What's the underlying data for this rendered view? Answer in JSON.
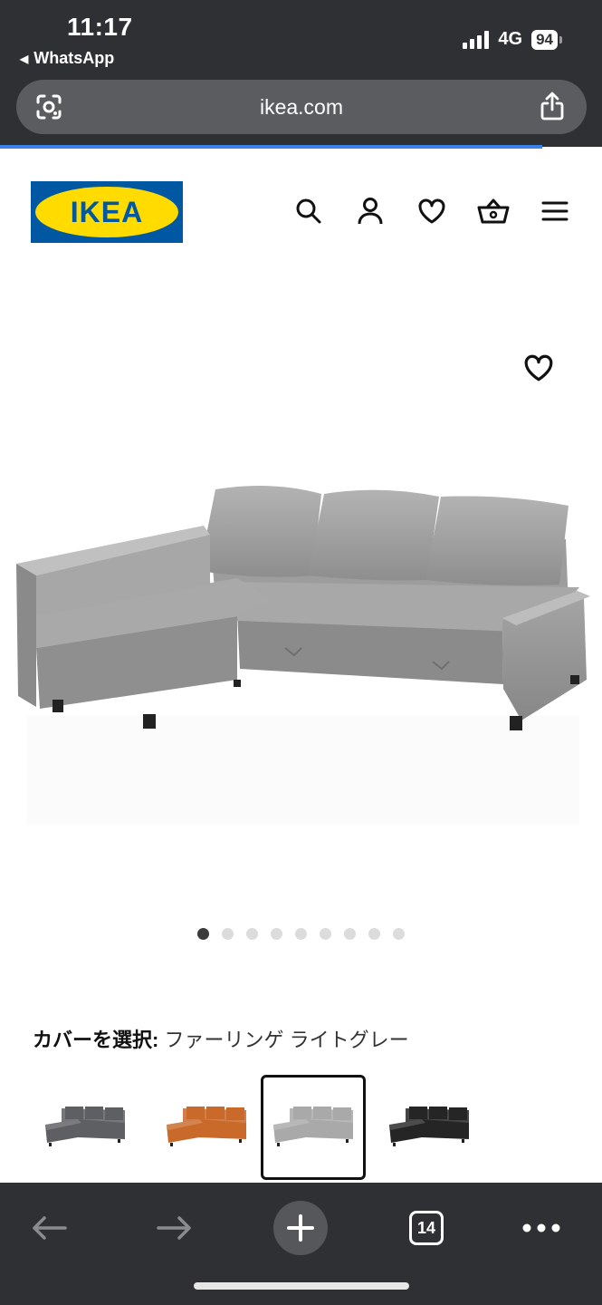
{
  "status_bar": {
    "time": "11:17",
    "back_app": "WhatsApp",
    "network": "4G",
    "battery": "94"
  },
  "browser": {
    "url": "ikea.com",
    "load_progress_percent": 90,
    "tab_count": "14"
  },
  "header": {
    "logo_text": "IKEA",
    "icons": [
      "search-icon",
      "account-icon",
      "heart-icon",
      "basket-icon",
      "menu-icon"
    ]
  },
  "gallery": {
    "image_count": 9,
    "active_index": 0
  },
  "cover": {
    "label": "カバーを選択:",
    "selected_value": "ファーリンゲ ライトグレー",
    "swatches": [
      {
        "name": "dark-grey",
        "color": "#5e5f63",
        "selected": false
      },
      {
        "name": "orange-leather",
        "color": "#c9692a",
        "selected": false
      },
      {
        "name": "light-grey",
        "color": "#a9a9a9",
        "selected": true
      },
      {
        "name": "black-leather",
        "color": "#252525",
        "selected": false
      }
    ]
  },
  "colors": {
    "ikea_blue": "#0058a3",
    "ikea_yellow": "#ffdb00",
    "chrome": "#2f3033",
    "progress": "#3b82e8"
  }
}
